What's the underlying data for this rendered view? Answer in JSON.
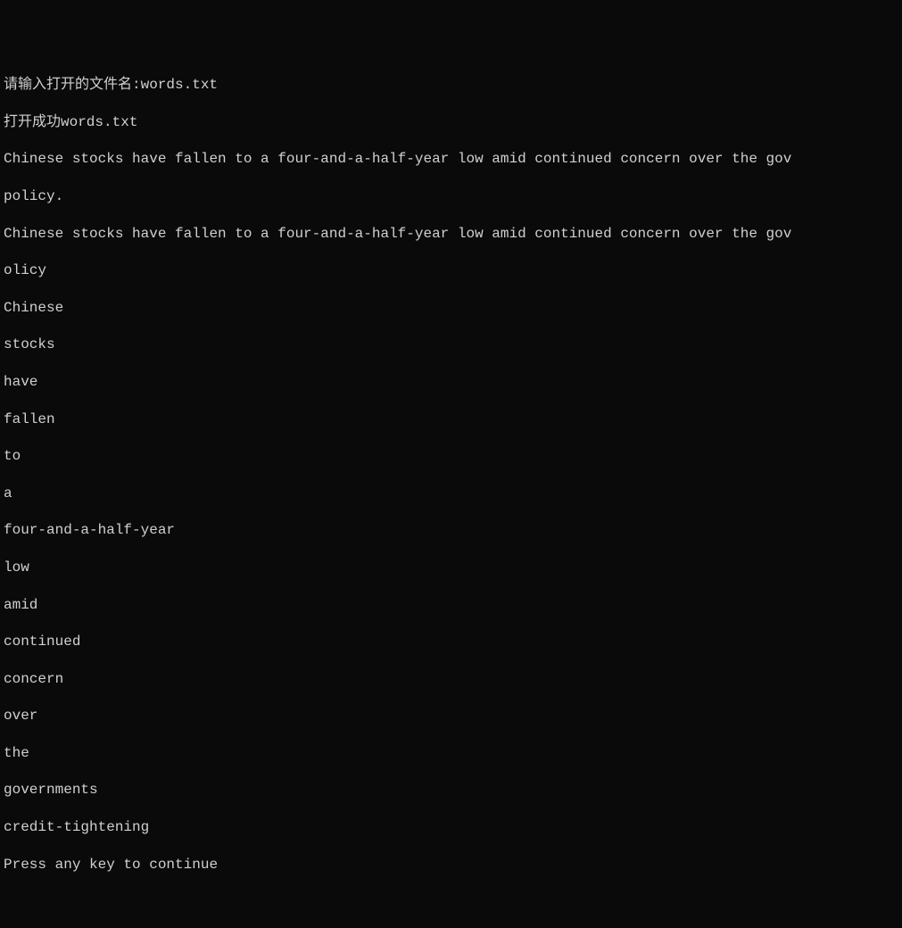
{
  "console": {
    "lines": {
      "prompt": "请输入打开的文件名:words.txt",
      "open_success": "打开成功words.txt",
      "sentence1": "Chinese stocks have fallen to a four-and-a-half-year low amid continued concern over the gov",
      "sentence1_cont": "policy.",
      "sentence2": "Chinese stocks have fallen to a four-and-a-half-year low amid continued concern over the gov",
      "sentence2_cont": "olicy",
      "word1": "Chinese",
      "word2": "stocks",
      "word3": "have",
      "word4": "fallen",
      "word5": "to",
      "word6": "a",
      "word7": "four-and-a-half-year",
      "word8": "low",
      "word9": "amid",
      "word10": "continued",
      "word11": "concern",
      "word12": "over",
      "word13": "the",
      "word14": "governments",
      "word15": "credit-tightening",
      "press_key": "Press any key to continue"
    }
  }
}
